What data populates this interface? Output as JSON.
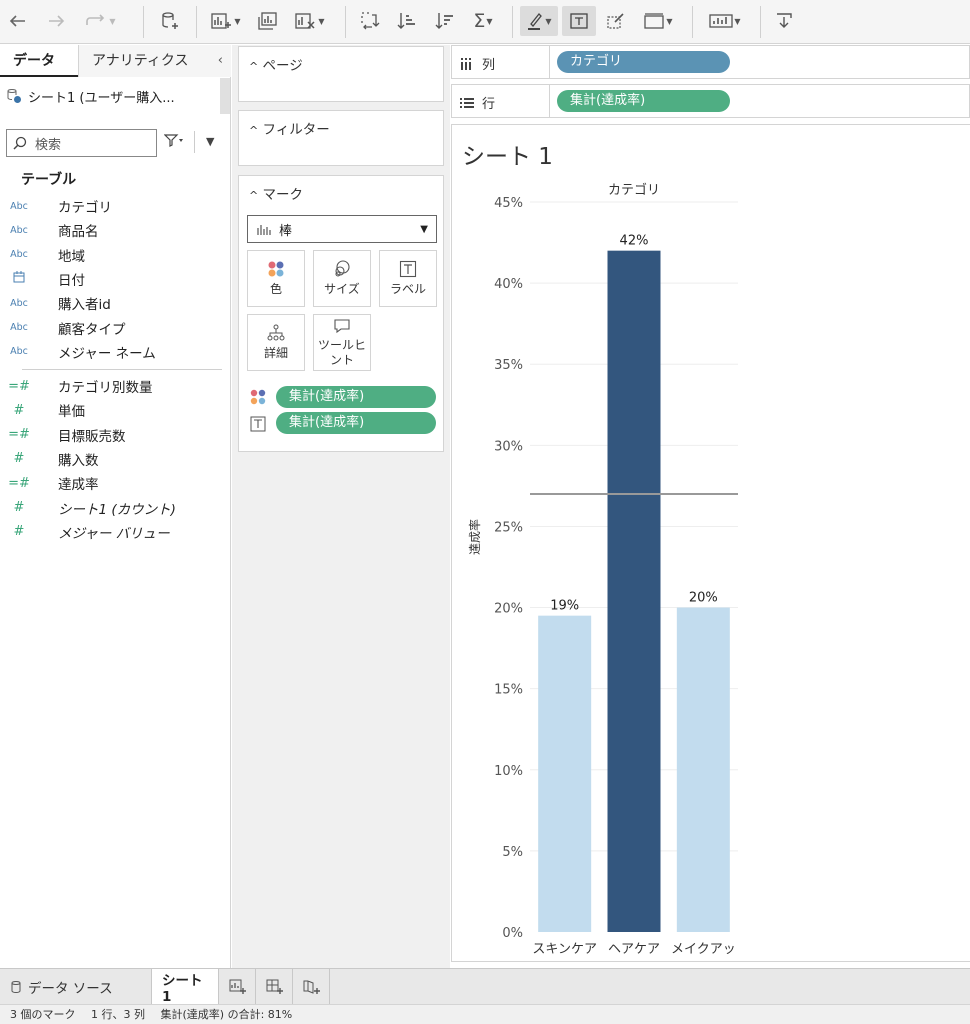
{
  "toolbar": {
    "buttons": [
      "undo-icon",
      "redo-icon",
      "redo-repeat-icon",
      "new-datasource-icon",
      "new-worksheet-icon",
      "duplicate-sheet-icon",
      "clear-sheet-icon",
      "swap-icon",
      "sort-ascending-icon",
      "sort-descending-icon",
      "totals-icon",
      "highlight-icon",
      "label-icon",
      "tooltip-icon",
      "fit-icon",
      "show-me-icon",
      "share-icon"
    ]
  },
  "left_pane": {
    "tab_data": "データ",
    "tab_analytics": "アナリティクス",
    "datasource": "シート1 (ユーザー購入...",
    "search_placeholder": "検索",
    "section_title": "テーブル",
    "dimensions": [
      {
        "icon": "Abc",
        "name": "カテゴリ"
      },
      {
        "icon": "Abc",
        "name": "商品名"
      },
      {
        "icon": "Abc",
        "name": "地域"
      },
      {
        "icon": "date",
        "name": "日付"
      },
      {
        "icon": "Abc",
        "name": "購入者id"
      },
      {
        "icon": "Abc",
        "name": "顧客タイプ"
      },
      {
        "icon": "Abc",
        "name": "メジャー ネーム"
      }
    ],
    "measures": [
      {
        "icon": "=#",
        "name": "カテゴリ別数量"
      },
      {
        "icon": "#",
        "name": "単価"
      },
      {
        "icon": "=#",
        "name": "目標販売数"
      },
      {
        "icon": "#",
        "name": "購入数"
      },
      {
        "icon": "=#",
        "name": "達成率"
      },
      {
        "icon": "#",
        "name": "シート1 (カウント)"
      },
      {
        "icon": "#",
        "name": "メジャー バリュー"
      }
    ]
  },
  "cards": {
    "pages_title": "ページ",
    "filters_title": "フィルター",
    "marks_title": "マーク",
    "mark_type": "棒",
    "mark_buttons": {
      "color": "色",
      "size": "サイズ",
      "label": "ラベル",
      "detail": "詳細",
      "tooltip": "ツールヒント"
    },
    "color_pill": "集計(達成率)",
    "label_pill": "集計(達成率)"
  },
  "shelves": {
    "columns_label": "列",
    "rows_label": "行",
    "columns_pill": "カテゴリ",
    "rows_pill": "集計(達成率)"
  },
  "colors": {
    "pill_green": "#4fae83",
    "pill_blue": "#5b93b4",
    "bar_dark": "#33567e",
    "bar_light": "#c2dcee"
  },
  "viz": {
    "sheet_title": "シート 1"
  },
  "chart_data": {
    "type": "bar",
    "title": "",
    "xlabel": "カテゴリ",
    "ylabel": "達成率",
    "categories": [
      "スキンケア",
      "ヘアケア",
      "メイクアップ"
    ],
    "category_labels": [
      "スキンケア",
      "ヘアケア",
      "メイクアッ"
    ],
    "values": [
      0.195,
      0.42,
      0.2
    ],
    "data_labels": [
      "19%",
      "42%",
      "20%"
    ],
    "yticks": [
      "0%",
      "5%",
      "10%",
      "15%",
      "20%",
      "25%",
      "30%",
      "35%",
      "40%",
      "45%"
    ],
    "ylim": [
      0,
      0.45
    ],
    "reference_line": 0.27,
    "grid": true
  },
  "bottom": {
    "datasource_tab": "データ ソース",
    "sheet_tab": "シート 1"
  },
  "status": {
    "marks": "3 個のマーク",
    "dims": "1 行、3 列",
    "sum": "集計(達成率) の合計: 81%"
  }
}
